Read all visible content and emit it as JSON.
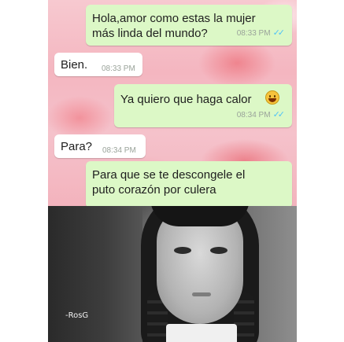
{
  "messages": [
    {
      "direction": "out",
      "text_line1": "Hola,amor como estas la mujer",
      "text_line2": "más linda del mundo?",
      "time": "08:33 PM",
      "read": true
    },
    {
      "direction": "in",
      "text": "Bien.",
      "time": "08:33 PM"
    },
    {
      "direction": "out",
      "text": "Ya quiero que haga calor",
      "emoji": "smiling-face-emoji",
      "time": "08:34 PM",
      "read": true
    },
    {
      "direction": "in",
      "text": "Para?",
      "time": "08:34 PM"
    },
    {
      "direction": "out",
      "text_line1": "Para que se te descongele el",
      "text_line2": "puto corazón por culera"
    }
  ],
  "photo": {
    "watermark": "-RosG"
  },
  "colors": {
    "outgoing_bubble": "#dcf8c6",
    "incoming_bubble": "#ffffff",
    "read_ticks": "#4fc3f7"
  }
}
